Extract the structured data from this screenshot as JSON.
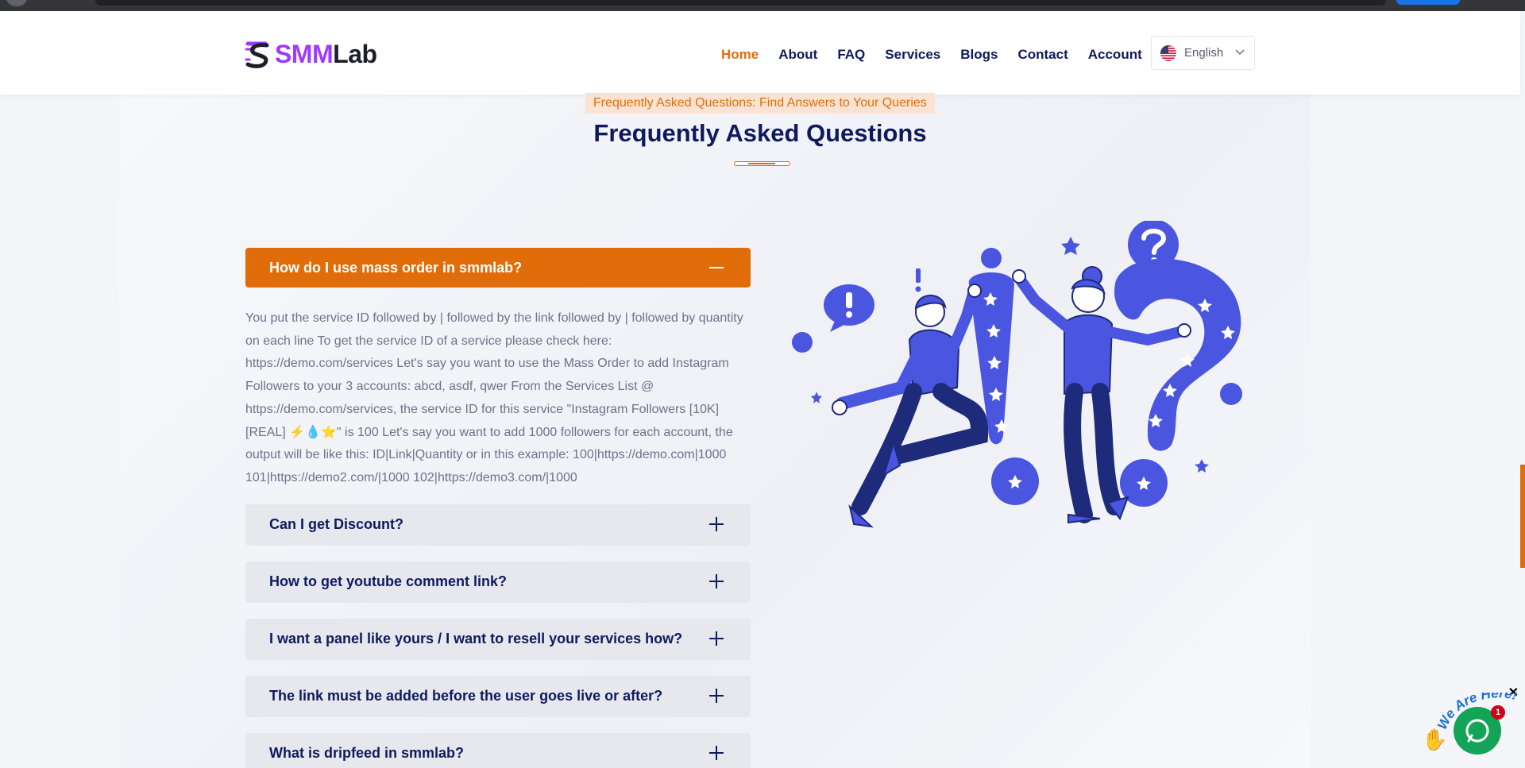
{
  "brand": {
    "name_part1": "SMM",
    "name_part2": "Lab",
    "accent": "#a238ff"
  },
  "nav": {
    "items": [
      {
        "label": "Home",
        "active": true
      },
      {
        "label": "About",
        "active": false
      },
      {
        "label": "FAQ",
        "active": false
      },
      {
        "label": "Services",
        "active": false
      },
      {
        "label": "Blogs",
        "active": false
      },
      {
        "label": "Contact",
        "active": false
      },
      {
        "label": "Account",
        "active": false
      }
    ],
    "language": "English"
  },
  "section": {
    "tagline": "Frequently Asked Questions: Find Answers to Your Queries",
    "title": "Frequently Asked Questions"
  },
  "faq": {
    "items": [
      {
        "question": "How do I use mass order in smmlab?",
        "open": true,
        "answer": "You put the service ID followed by | followed by the link followed by | followed by quantity on each line To get the service ID of a service please check here: https://demo.com/services Let's say you want to use the Mass Order to add Instagram Followers to your 3 accounts: abcd, asdf, qwer From the Services List @ https://demo.com/services, the service ID for this service \"Instagram Followers [10K] [REAL] ⚡💧⭐\" is 100 Let's say you want to add 1000 followers for each account, the output will be like this: ID|Link|Quantity or in this example: 100|https://demo.com|1000 101|https://demo2.com/|1000 102|https://demo3.com/|1000"
      },
      {
        "question": "Can I get Discount?",
        "open": false
      },
      {
        "question": "How to get youtube comment link?",
        "open": false
      },
      {
        "question": "I want a panel like yours / I want to resell your services how?",
        "open": false
      },
      {
        "question": "The link must be added before the user goes live or after?",
        "open": false
      },
      {
        "question": "What is dripfeed in smmlab?",
        "open": false
      }
    ]
  },
  "chat": {
    "label": "We Are Here!",
    "badge": "1",
    "close": "✕"
  },
  "colors": {
    "primary": "#e06d0a",
    "navy": "#0f1a5e",
    "illustration": "#4a55e0"
  }
}
